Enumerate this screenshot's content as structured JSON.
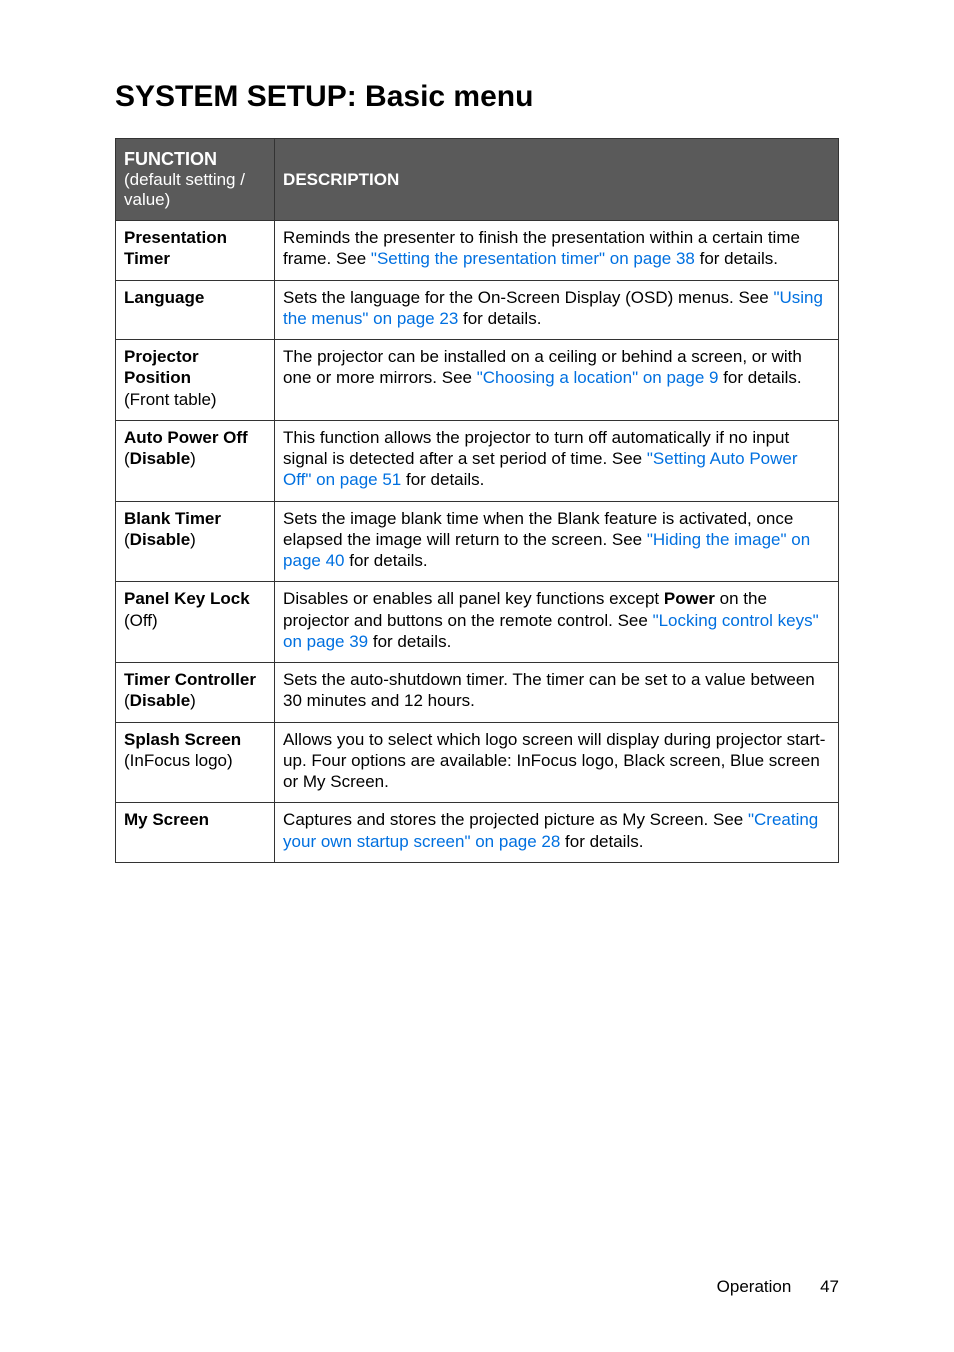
{
  "title": "SYSTEM SETUP: Basic menu",
  "headers": {
    "func_title": "FUNCTION",
    "func_sub": "(default setting / value)",
    "desc": "DESCRIPTION"
  },
  "rows": [
    {
      "name": "Presentation Timer",
      "setting": "",
      "setting_bold": false,
      "desc_pre": "Reminds the presenter to finish the presentation within a certain time frame. See ",
      "link": "\"Setting the presentation timer\" on page 38",
      "desc_post": " for details."
    },
    {
      "name": "Language",
      "setting": "",
      "setting_bold": false,
      "desc_pre": "Sets the language for the On-Screen Display (OSD) menus. See ",
      "link": "\"Using the menus\" on page 23",
      "desc_post": " for details."
    },
    {
      "name": "Projector Position",
      "setting": "(Front table)",
      "setting_bold": false,
      "desc_pre": "The projector can be installed on a ceiling or behind a screen, or with one or more mirrors. See ",
      "link": "\"Choosing a location\" on page 9",
      "desc_post": " for details."
    },
    {
      "name": "Auto Power Off",
      "setting_pre": "(",
      "setting_bold_text": "Disable",
      "setting_post": ")",
      "setting_bold": true,
      "desc_pre": "This function allows the projector to turn off automatically if no input signal is detected after a set period of time. See ",
      "link": "\"Setting Auto Power Off\" on page 51",
      "desc_post": " for details."
    },
    {
      "name": "Blank Timer",
      "setting_pre": "(",
      "setting_bold_text": "Disable",
      "setting_post": ")",
      "setting_bold": true,
      "desc_pre": "Sets the image blank time when the Blank feature is activated, once elapsed the image will return to the screen. See ",
      "link": "\"Hiding the image\" on page 40",
      "desc_post": " for details."
    },
    {
      "name": "Panel Key Lock",
      "setting": "(Off)",
      "setting_bold": false,
      "desc_pre": "Disables or enables all panel key functions except ",
      "bold_inline": "Power",
      "desc_mid": " on the projector and buttons on the remote control. See ",
      "link": "\"Locking control keys\" on page 39",
      "desc_post": " for details."
    },
    {
      "name": "Timer Controller",
      "setting_pre": "(",
      "setting_bold_text": "Disable",
      "setting_post": ")",
      "setting_bold": true,
      "desc_pre": "Sets the auto-shutdown timer. The timer can be set to a value between 30 minutes and 12 hours.",
      "link": "",
      "desc_post": ""
    },
    {
      "name": "Splash Screen",
      "setting": "(InFocus logo)",
      "setting_bold": false,
      "desc_pre": "Allows you to select which logo screen will display during projector start-up. Four options are available: InFocus logo, Black screen, Blue screen or My Screen.",
      "link": "",
      "desc_post": ""
    },
    {
      "name": "My Screen",
      "setting": "",
      "setting_bold": false,
      "desc_pre": "Captures and stores the projected picture as My Screen. See ",
      "link": "\"Creating your own startup screen\" on page 28",
      "desc_post": " for details."
    }
  ],
  "footer": {
    "section": "Operation",
    "page": "47"
  }
}
